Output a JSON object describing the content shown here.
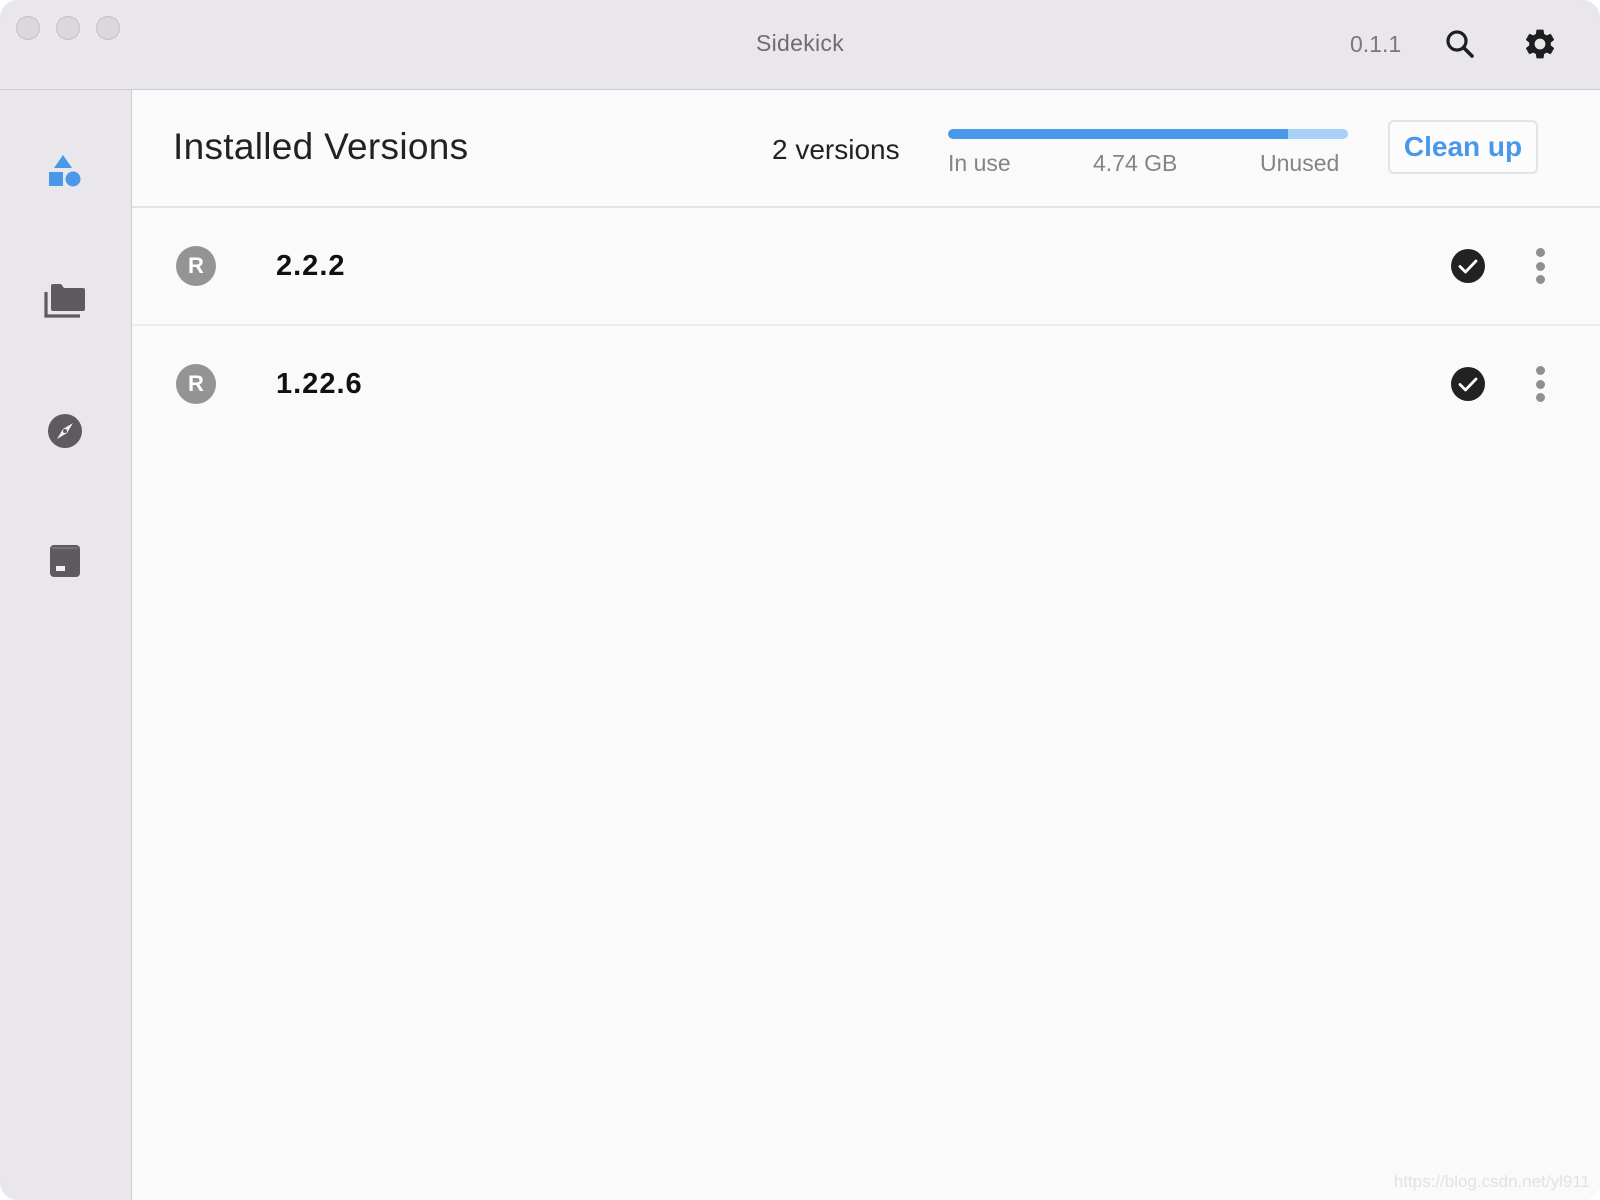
{
  "window": {
    "title": "Sidekick",
    "version": "0.1.1",
    "titlebar_icons": [
      "search-icon",
      "gear-icon"
    ]
  },
  "sidebar": {
    "items": [
      {
        "name": "shapes",
        "icon": "shapes-icon",
        "active": true
      },
      {
        "name": "folders",
        "icon": "folders-icon",
        "active": false
      },
      {
        "name": "explore",
        "icon": "compass-icon",
        "active": false
      },
      {
        "name": "archive",
        "icon": "archive-icon",
        "active": false
      }
    ]
  },
  "header": {
    "title": "Installed Versions",
    "count_label": "2 versions",
    "storage": {
      "in_use_label": "In use",
      "total_label": "4.74 GB",
      "unused_label": "Unused",
      "in_use_fraction": 0.85
    },
    "cleanup_label": "Clean up"
  },
  "versions": [
    {
      "badge": "R",
      "version": "2.2.2",
      "installed": true
    },
    {
      "badge": "R",
      "version": "1.22.6",
      "installed": true
    }
  ],
  "colors": {
    "accent": "#4a98ea",
    "accent_light": "#a9d0f7",
    "sidebar_bg": "#e9e6ec",
    "content_bg": "#fafafa"
  },
  "watermark": "https://blog.csdn.net/yl911"
}
